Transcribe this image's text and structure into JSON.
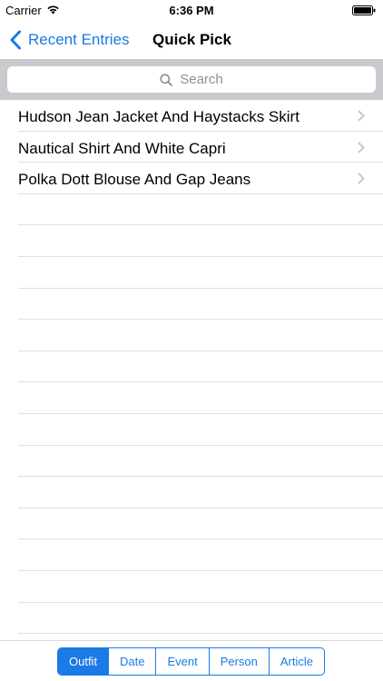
{
  "status_bar": {
    "carrier": "Carrier",
    "time": "6:36 PM"
  },
  "nav": {
    "back_label": "Recent Entries",
    "title": "Quick Pick"
  },
  "search": {
    "placeholder": "Search"
  },
  "list": {
    "items": [
      {
        "label": "Hudson Jean Jacket And Haystacks Skirt"
      },
      {
        "label": "Nautical Shirt And White Capri"
      },
      {
        "label": "Polka Dott Blouse And Gap Jeans"
      }
    ]
  },
  "toolbar": {
    "segments": [
      {
        "label": "Outfit",
        "selected": true
      },
      {
        "label": "Date",
        "selected": false
      },
      {
        "label": "Event",
        "selected": false
      },
      {
        "label": "Person",
        "selected": false
      },
      {
        "label": "Article",
        "selected": false
      }
    ]
  },
  "colors": {
    "accent": "#1a7ae6",
    "search_bar_bg": "#c9c9ce",
    "separator": "#e0e0e0"
  },
  "icons": [
    "wifi-icon",
    "battery-icon",
    "back-chevron-icon",
    "search-icon",
    "disclosure-icon"
  ]
}
